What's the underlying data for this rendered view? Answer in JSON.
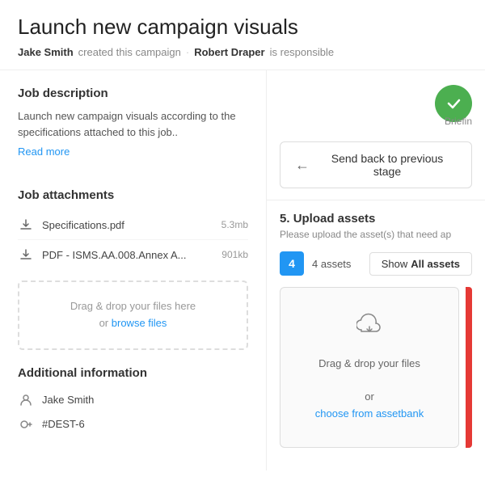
{
  "header": {
    "title": "Launch new campaign visuals",
    "creator_label": "Jake Smith",
    "created_text": "created this campaign",
    "separator": "·",
    "responsible_label": "Robert Draper",
    "responsible_text": "is responsible"
  },
  "left": {
    "job_description_title": "Job description",
    "job_description_text": "Launch new campaign visuals according to the specifications attached to this job..",
    "read_more_label": "Read more",
    "attachments_title": "Job attachments",
    "attachments": [
      {
        "name": "Specifications.pdf",
        "size": "5.3mb"
      },
      {
        "name": "PDF - ISMS.AA.008.Annex A...",
        "size": "901kb"
      }
    ],
    "dropzone_text": "Drag & drop your files here",
    "dropzone_or": "or",
    "browse_label": "browse files",
    "additional_info_title": "Additional information",
    "info_person": "Jake Smith",
    "info_id": "#DEST-6"
  },
  "right": {
    "send_back_label": "Send back to previous stage",
    "briefing_label": "Briefin",
    "upload_section_number": "5.",
    "upload_section_title": "Upload assets",
    "upload_section_desc": "Please upload the asset(s) that need ap",
    "assets_count": "4",
    "assets_label": "4 assets",
    "show_label": "Show",
    "all_label": "All assets",
    "dropzone_line1": "Drag & drop your files",
    "dropzone_or": "or",
    "choose_label": "choose from assetbank"
  }
}
